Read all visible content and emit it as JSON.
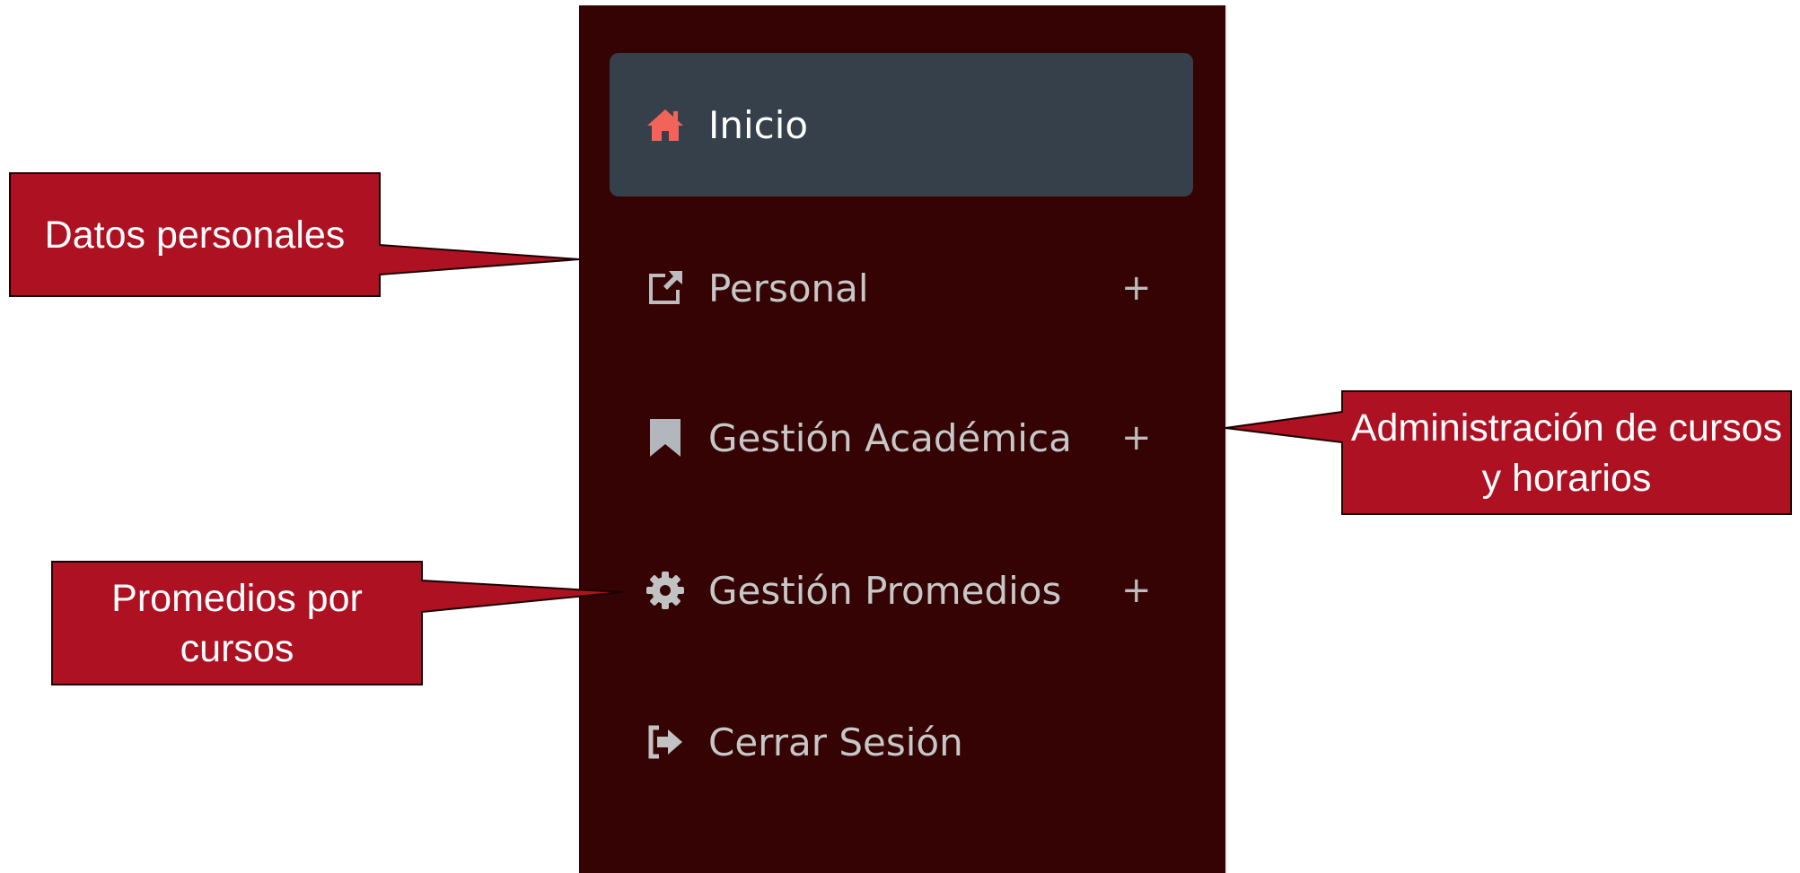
{
  "sidebar": {
    "items": [
      {
        "label": "Inicio",
        "icon": "home-icon",
        "active": true,
        "expandable": false
      },
      {
        "label": "Personal",
        "icon": "external-link-icon",
        "active": false,
        "expandable": true
      },
      {
        "label": "Gestión Académica",
        "icon": "bookmark-icon",
        "active": false,
        "expandable": true
      },
      {
        "label": "Gestión Promedios",
        "icon": "gear-icon",
        "active": false,
        "expandable": true
      },
      {
        "label": "Cerrar Sesión",
        "icon": "sign-out-icon",
        "active": false,
        "expandable": false
      }
    ],
    "expand_symbol": "+"
  },
  "callouts": {
    "datos": "Datos personales",
    "admin": "Administración de cursos y horarios",
    "promedios": "Promedios por cursos"
  },
  "colors": {
    "sidebar_bg": "#350303",
    "active_bg": "#35404b",
    "home_icon": "#f2645a",
    "callout_fill": "#ad1122"
  }
}
